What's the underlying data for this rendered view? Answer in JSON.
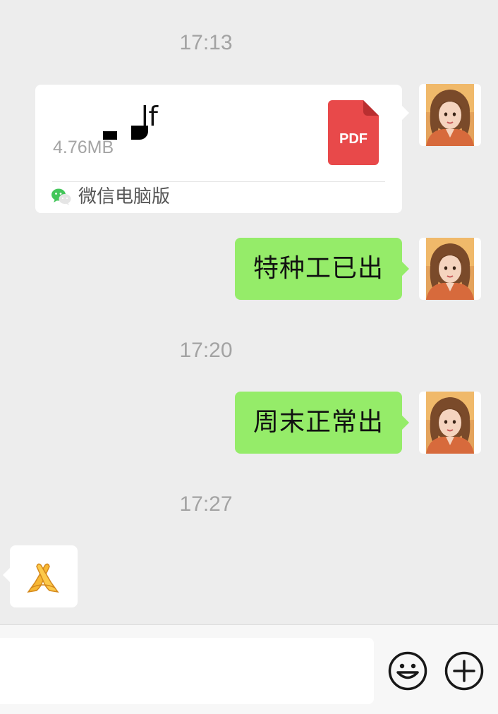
{
  "timestamps": [
    "17:13",
    "17:20",
    "17:27"
  ],
  "file_message": {
    "file_name_visible": "lf",
    "file_size": "4.76MB",
    "file_type_badge": "PDF",
    "source_label": "微信电脑版"
  },
  "messages": [
    {
      "direction": "outgoing",
      "text": "特种工已出"
    },
    {
      "direction": "outgoing",
      "text": "周末正常出"
    },
    {
      "direction": "incoming",
      "emoji_name": "folded-hands-emoji"
    }
  ],
  "input_bar": {
    "placeholder": "",
    "emoji_button": "smile-icon",
    "more_button": "plus-icon"
  },
  "colors": {
    "background": "#ededed",
    "bubble_out": "#95ec69",
    "bubble_in": "#ffffff",
    "pdf_red": "#e8494a",
    "timestamp": "#a3a3a3"
  }
}
